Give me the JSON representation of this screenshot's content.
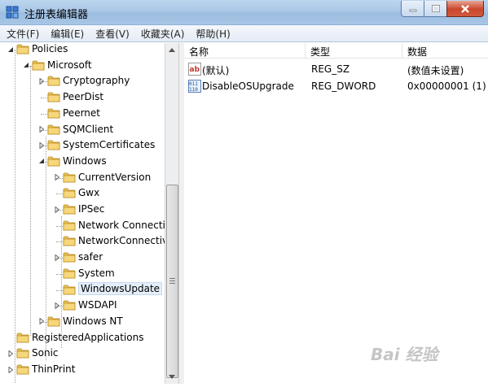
{
  "window": {
    "title": "注册表编辑器"
  },
  "menu": [
    "文件(F)",
    "编辑(E)",
    "查看(V)",
    "收藏夹(A)",
    "帮助(H)"
  ],
  "tree": [
    {
      "label": "Policies",
      "level": 0,
      "state": "open"
    },
    {
      "label": "Microsoft",
      "level": 1,
      "state": "open"
    },
    {
      "label": "Cryptography",
      "level": 2,
      "state": "closed"
    },
    {
      "label": "PeerDist",
      "level": 2,
      "state": "none"
    },
    {
      "label": "Peernet",
      "level": 2,
      "state": "none"
    },
    {
      "label": "SQMClient",
      "level": 2,
      "state": "closed"
    },
    {
      "label": "SystemCertificates",
      "level": 2,
      "state": "closed"
    },
    {
      "label": "Windows",
      "level": 2,
      "state": "open"
    },
    {
      "label": "CurrentVersion",
      "level": 3,
      "state": "closed"
    },
    {
      "label": "Gwx",
      "level": 3,
      "state": "none"
    },
    {
      "label": "IPSec",
      "level": 3,
      "state": "closed"
    },
    {
      "label": "Network Connectio",
      "level": 3,
      "state": "none"
    },
    {
      "label": "NetworkConnectivi",
      "level": 3,
      "state": "none"
    },
    {
      "label": "safer",
      "level": 3,
      "state": "closed"
    },
    {
      "label": "System",
      "level": 3,
      "state": "none"
    },
    {
      "label": "WindowsUpdate",
      "level": 3,
      "state": "none",
      "selected": true
    },
    {
      "label": "WSDAPI",
      "level": 3,
      "state": "closed"
    },
    {
      "label": "Windows NT",
      "level": 2,
      "state": "closed"
    },
    {
      "label": "RegisteredApplications",
      "level": 0,
      "state": "none"
    },
    {
      "label": "Sonic",
      "level": 0,
      "state": "closed"
    },
    {
      "label": "ThinPrint",
      "level": 0,
      "state": "closed"
    }
  ],
  "columns": [
    "名称",
    "类型",
    "数据"
  ],
  "values": [
    {
      "name": "(默认)",
      "type": "REG_SZ",
      "data": "(数值未设置)",
      "icon": "string-value-icon"
    },
    {
      "name": "DisableOSUpgrade",
      "type": "REG_DWORD",
      "data": "0x00000001 (1)",
      "icon": "binary-value-icon"
    }
  ],
  "watermark": "Bai 经验"
}
